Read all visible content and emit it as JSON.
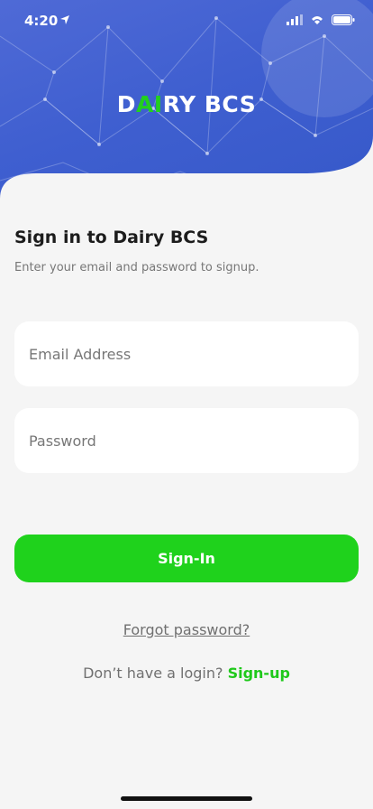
{
  "status_bar": {
    "time": "4:20"
  },
  "brand": {
    "logo_part1": "D",
    "logo_highlight": "AI",
    "logo_part2": "RY BCS",
    "accent": "#22d01d",
    "hero_color": "#3f5fd0"
  },
  "signin": {
    "title": "Sign in to Dairy BCS",
    "subtitle": "Enter your email and password to signup.",
    "email_placeholder": "Email Address",
    "password_placeholder": "Password",
    "button_label": "Sign-In",
    "button_color": "#1fd21c"
  },
  "links": {
    "forgot": "Forgot password?",
    "no_login": "Don’t have a login?",
    "signup": "Sign-up"
  }
}
